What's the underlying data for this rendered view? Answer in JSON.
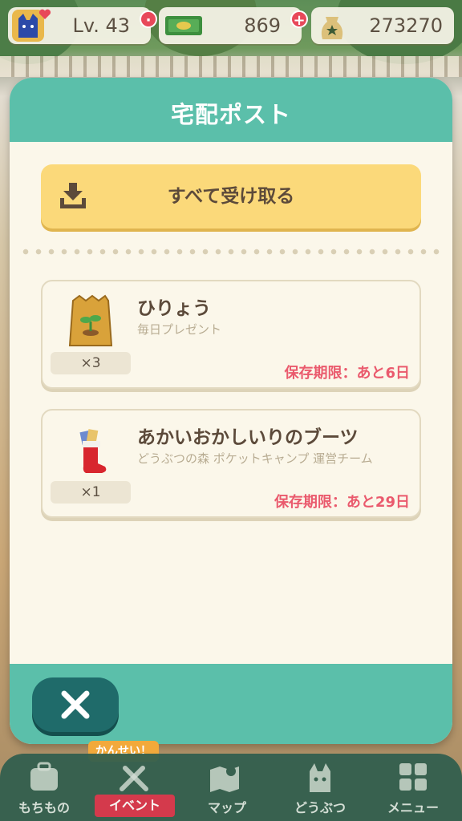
{
  "status": {
    "level": "Lv. 43",
    "tickets": "869",
    "bells": "273270"
  },
  "modal": {
    "title": "宅配ポスト",
    "receive_all_label": "すべて受け取る",
    "items": [
      {
        "name": "ひりょう",
        "sender": "毎日プレゼント",
        "quantity": "×3",
        "expiry": "保存期限：あと6日",
        "icon": "fertilizer-bag-icon"
      },
      {
        "name": "あかいおかしいりのブーツ",
        "sender": "どうぶつの森 ポケットキャンプ 運営チーム",
        "quantity": "×1",
        "expiry": "保存期限：あと29日",
        "icon": "red-candy-boot-icon"
      }
    ]
  },
  "nav": {
    "complete_badge": "かんせい！",
    "items": [
      {
        "label": "もちもの",
        "icon": "bag-icon"
      },
      {
        "label": "イベント",
        "icon": "event-tools-icon",
        "active": true
      },
      {
        "label": "マップ",
        "icon": "map-icon"
      },
      {
        "label": "どうぶつ",
        "icon": "animal-cat-icon"
      },
      {
        "label": "メニュー",
        "icon": "menu-grid-icon"
      }
    ]
  },
  "colors": {
    "accent": "#5bbfaa",
    "button_yellow": "#fbd97a",
    "expiry_red": "#ea5a6d",
    "close_button": "#1f6b6a"
  }
}
